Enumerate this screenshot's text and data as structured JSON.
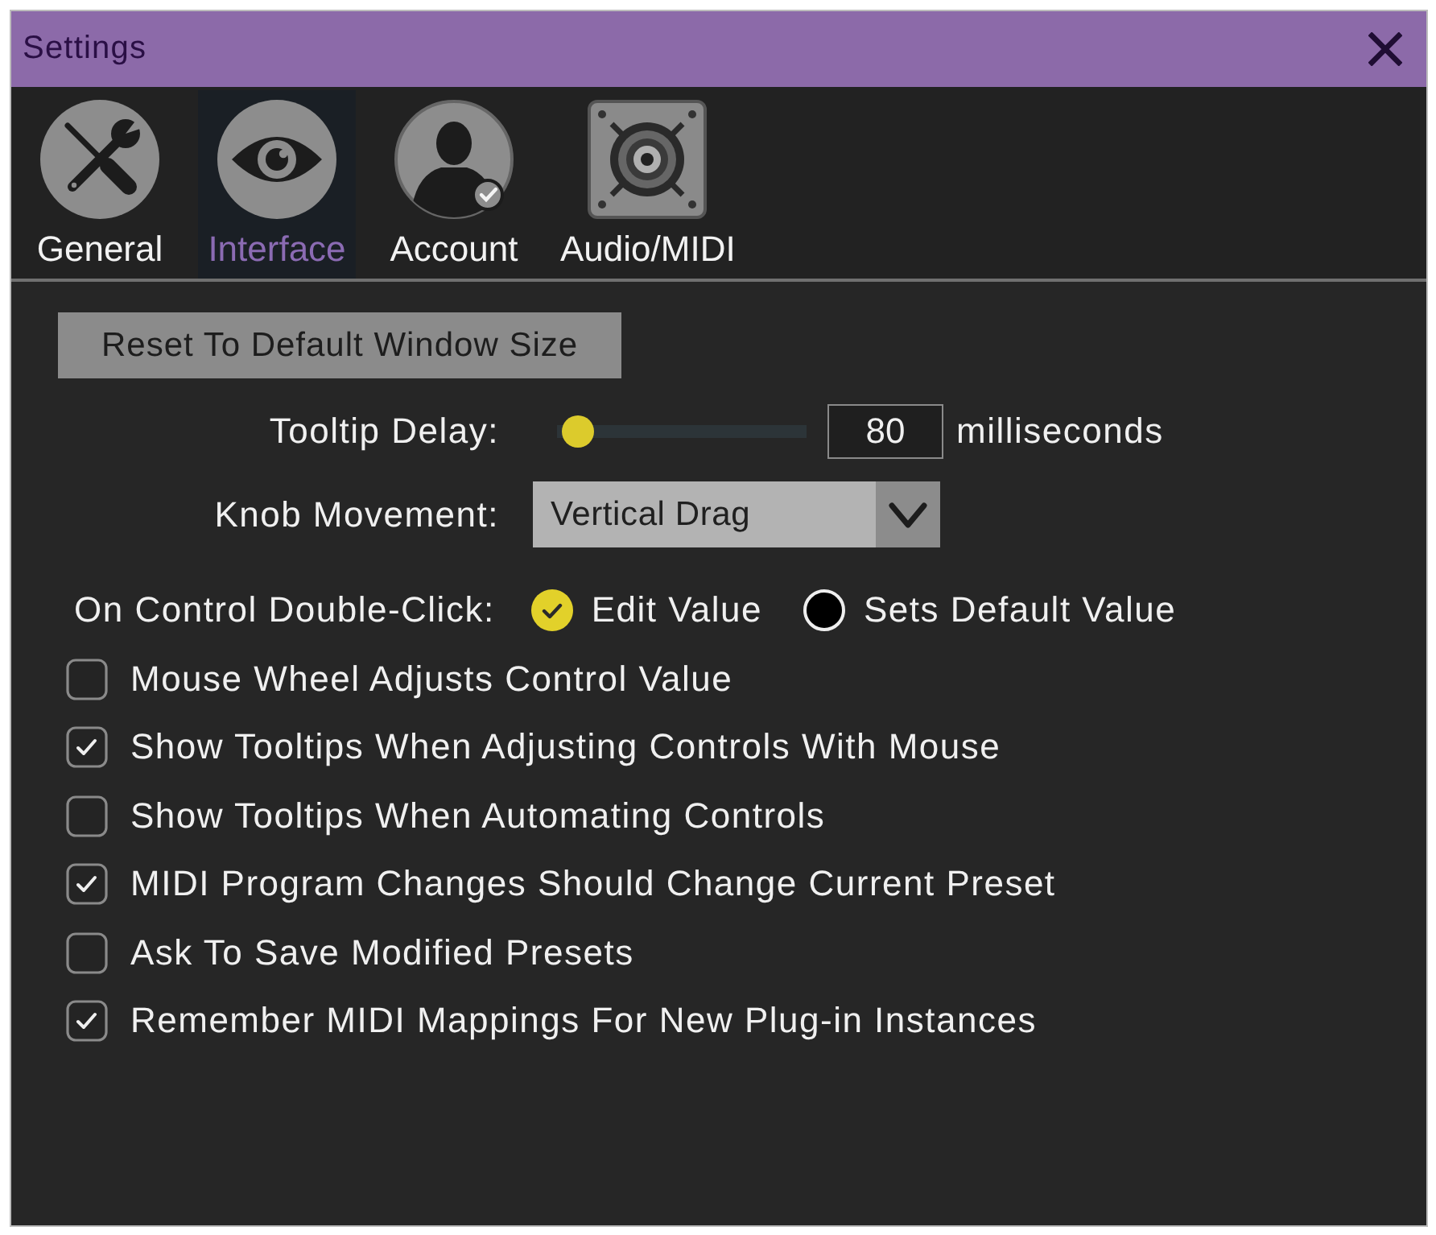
{
  "window": {
    "title": "Settings"
  },
  "tabs": [
    {
      "label": "General",
      "selected": false
    },
    {
      "label": "Interface",
      "selected": true
    },
    {
      "label": "Account",
      "selected": false
    },
    {
      "label": "Audio/MIDI",
      "selected": false
    }
  ],
  "reset_button": {
    "label": "Reset To Default Window Size"
  },
  "tooltip_delay": {
    "label": "Tooltip Delay:",
    "level": 0.02,
    "value": "80",
    "unit": "milliseconds"
  },
  "knob_movement": {
    "label": "Knob Movement:",
    "value": "Vertical Drag"
  },
  "double_click": {
    "label": "On Control Double-Click:",
    "options": [
      {
        "label": "Edit Value",
        "selected": true
      },
      {
        "label": "Sets Default Value",
        "selected": false
      }
    ]
  },
  "checkboxes": [
    {
      "label": "Mouse Wheel Adjusts Control Value",
      "checked": false
    },
    {
      "label": "Show Tooltips When Adjusting Controls With Mouse",
      "checked": true
    },
    {
      "label": "Show Tooltips When Automating Controls",
      "checked": false
    },
    {
      "label": "MIDI Program Changes Should Change Current Preset",
      "checked": true
    },
    {
      "label": "Ask To Save Modified Presets",
      "checked": false
    },
    {
      "label": "Remember MIDI Mappings For New Plug-in Instances",
      "checked": true
    }
  ]
}
